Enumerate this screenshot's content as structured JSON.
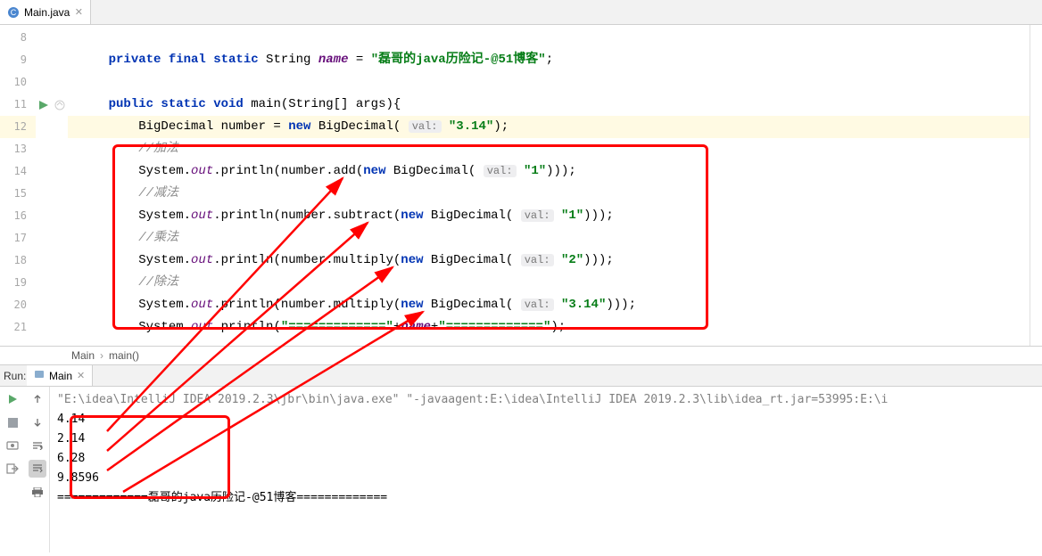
{
  "tab": {
    "filename": "Main.java"
  },
  "gutter": {
    "start": 8,
    "end": 21,
    "current": 12,
    "run_triangle_at": 11
  },
  "code": {
    "l8": "",
    "l9_indent": "    ",
    "l9_kw1": "private final static",
    "l9_type": " String ",
    "l9_var": "name",
    "l9_eq": " = ",
    "l9_str": "\"磊哥的java历险记-@51博客\"",
    "l9_end": ";",
    "l10": "",
    "l11_indent": "    ",
    "l11_kw": "public static void",
    "l11_rest": " main(String[] args){",
    "l12_indent": "        BigDecimal number = ",
    "l12_new": "new",
    "l12_mid": " BigDecimal( ",
    "l12_hint": "val:",
    "l12_sp": " ",
    "l12_str": "\"3.14\"",
    "l12_end": ");",
    "l13_indent": "        ",
    "l13_comment": "//加法",
    "l14_indent": "        System.",
    "l14_out": "out",
    "l14_mid1": ".println(number.add(",
    "l14_new": "new",
    "l14_mid2": " BigDecimal( ",
    "l14_hint": "val:",
    "l14_sp": " ",
    "l14_str": "\"1\"",
    "l14_end": ")));",
    "l15_indent": "        ",
    "l15_comment": "//减法",
    "l16_indent": "        System.",
    "l16_out": "out",
    "l16_mid1": ".println(number.subtract(",
    "l16_new": "new",
    "l16_mid2": " BigDecimal( ",
    "l16_hint": "val:",
    "l16_sp": " ",
    "l16_str": "\"1\"",
    "l16_end": ")));",
    "l17_indent": "        ",
    "l17_comment": "//乘法",
    "l18_indent": "        System.",
    "l18_out": "out",
    "l18_mid1": ".println(number.multiply(",
    "l18_new": "new",
    "l18_mid2": " BigDecimal( ",
    "l18_hint": "val:",
    "l18_sp": " ",
    "l18_str": "\"2\"",
    "l18_end": ")));",
    "l19_indent": "        ",
    "l19_comment": "//除法",
    "l20_indent": "        System.",
    "l20_out": "out",
    "l20_mid1": ".println(number.multiply(",
    "l20_new": "new",
    "l20_mid2": " BigDecimal( ",
    "l20_hint": "val:",
    "l20_sp": " ",
    "l20_str": "\"3.14\"",
    "l20_end": ")));",
    "l21_indent": "        System.",
    "l21_out": "out",
    "l21_mid1": ".println(",
    "l21_str1": "\"=============\"",
    "l21_plus1": "+",
    "l21_var": "name",
    "l21_plus2": "+",
    "l21_str2": "\"=============\"",
    "l21_end": ");"
  },
  "breadcrumb": {
    "a": "Main",
    "b": "main()"
  },
  "run": {
    "label": "Run:",
    "tab": "Main",
    "cmd": "\"E:\\idea\\IntelliJ IDEA 2019.2.3\\jbr\\bin\\java.exe\" \"-javaagent:E:\\idea\\IntelliJ IDEA 2019.2.3\\lib\\idea_rt.jar=53995:E:\\i",
    "out1": "4.14",
    "out2": "2.14",
    "out3": "6.28",
    "out4": "9.8596",
    "out5": "=============磊哥的java历险记-@51博客============="
  }
}
